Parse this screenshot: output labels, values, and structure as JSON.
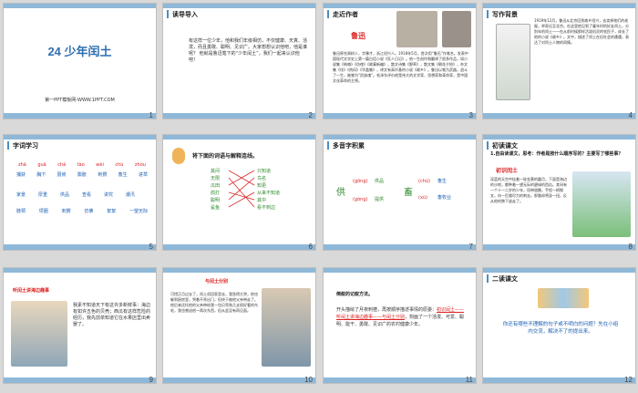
{
  "slides": [
    {
      "num": "1",
      "title": "24 少年闰土",
      "footer": "第一PPT模板网-WWW.1PPT.COM"
    },
    {
      "num": "2",
      "header": "读导导入",
      "body": "有这样一位少年，他和我们年级相仿，不仅健康、天真、活泼，而且勇敢、聪明、见识广。大家想想认识他吧，他是谁呢？ 他就是鲁迅笔下的“少年闰土”，我们一起来认识他吧！"
    },
    {
      "num": "3",
      "header": "走近作者",
      "name": "鲁迅",
      "body": "鲁迅原名周树人，字豫才，浙江绍兴人。1918年5月，首次用“鲁迅”作笔名，发表中国现代文学史上第一篇白话小说《狂人日记》。他一生创作和翻译了很多作品，如小说集《呐喊》《彷徨》《故事新编》，散文诗集《野草》，散文集《朝花夕拾》，杂文集《坟》《热风》《华盖集》，译文有高尔基的小说《故乡》。鲁迅以笔为武器，战斗了一生，被誉为“民族魂”。毛泽东评价他是伟大的文学家、思想家和革命家，是中国文化革命的主将。"
    },
    {
      "num": "4",
      "header": "写作背景",
      "body": "1919年12月，鲁迅从北京回到故乡绍兴，去卖掉他们的老屋，举家迁至北京。在这里他见到了童年时的好友闰土。分别年的闰土——在从前时候那样活泼机灵的农民子，成长了他的小说《故乡》。文中，描述了闰土在旧社会的遭遇，表达了对闰土人物的同情。"
    },
    {
      "num": "5",
      "header": "字词学习",
      "pinyin": [
        "zhā",
        "guā",
        "chá",
        "tào",
        "wèi",
        "chù",
        "zhòu"
      ],
      "row1": [
        "捕获",
        "胸下",
        "厨房",
        "膨胀",
        "刺猬",
        "畜生",
        "进草"
      ],
      "row2": [
        "家景",
        "厚重",
        "供品",
        "查看",
        "讲究",
        "潮汛"
      ],
      "row3": [
        "脖颈",
        "项圈",
        "刺猬",
        "仿佛",
        "絮絮",
        "一望无际"
      ]
    },
    {
      "num": "6",
      "header": "将下面的词语与解释连线。",
      "left": [
        "其间",
        "无限",
        "瓜田",
        "鸽打",
        "聪明",
        "鲨鱼"
      ],
      "right": [
        "只知道",
        "鸟名",
        "知更",
        "从来不知道",
        "其中",
        "看不到边"
      ]
    },
    {
      "num": "7",
      "header": "多音字积累",
      "ch1": "供",
      "p1a": "(gōng)",
      "w1a": "供品",
      "p1b": "(gòng)",
      "w1b": "提供",
      "ch2": "畜",
      "p2a": "(chù)",
      "w2a": "畜生",
      "p2b": "(xù)",
      "w2b": "畜牧业"
    },
    {
      "num": "8",
      "header": "初读课文",
      "q": "1.自由读课文，思考：作者是按什么顺序写的？主要写了哪些事？",
      "sub": "初识闰土",
      "body": "深蓝的天空中挂着一轮金黄的圆月，下面是海边的沙地，都种着一望无际的碧绿的西瓜。其间有一个十一二岁的少年，项带银圈，手捏一柄钢叉，向一匹猹尽力的刺去。那猹却将身一扭，反从他的胯下逃走了。"
    },
    {
      "num": "9",
      "title": "听闰土讲海边趣事",
      "body": "我素不知道天下有这许多新鲜事：海边有如许五色的贝壳；西瓜有这样危险的经历，我先前单知道它在水果店里出卖罢了。"
    },
    {
      "num": "10",
      "title": "与闰土分别",
      "body": "可惜正月过去了，闰土须回家里去，我急得大哭，他也躲到厨房里，哭着不肯出门，但终于被他父亲带走了。他后来还托他的父亲带给我一包贝壳和几支很好看的鸟毛，我也曾送他一两次东西，但从此没有再见面。"
    },
    {
      "num": "11",
      "title": "倒叙的记叙方法。",
      "body1": "开头描绘了月夜刺猹，再按顺序描述事情的原委：",
      "body2": "初识闰土——听闰土讲海边趣事——与闰土分别",
      "body3": "，刻画了一个活泼、可爱、聪明、能干、勇敢、见识广的农村健康少年。"
    },
    {
      "num": "12",
      "header": "二读课文",
      "body": "你还有哪些不理解的句子或不明白的问题？先在小组内交流，解决不了的提出来。"
    }
  ]
}
